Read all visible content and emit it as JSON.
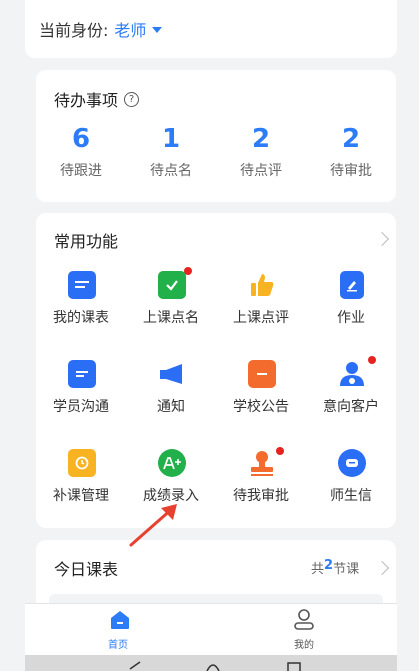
{
  "identity": {
    "label": "当前身份:",
    "role": "老师"
  },
  "todo": {
    "title": "待办事项",
    "help_icon": "question-circle-icon",
    "items": [
      {
        "count": "6",
        "label": "待跟进"
      },
      {
        "count": "1",
        "label": "待点名"
      },
      {
        "count": "2",
        "label": "待点评"
      },
      {
        "count": "2",
        "label": "待审批"
      }
    ]
  },
  "functions": {
    "title": "常用功能",
    "items": [
      {
        "label": "我的课表",
        "icon": "calendar-list-icon",
        "color": "#2b6ef6",
        "badge": false
      },
      {
        "label": "上课点名",
        "icon": "calendar-check-icon",
        "color": "#22b04b",
        "badge": true
      },
      {
        "label": "上课点评",
        "icon": "thumbs-up-icon",
        "color": "#f7b322",
        "badge": false
      },
      {
        "label": "作业",
        "icon": "document-edit-icon",
        "color": "#2b6ef6",
        "badge": false
      },
      {
        "label": "学员沟通",
        "icon": "chat-bubble-icon",
        "color": "#2b6ef6",
        "badge": false
      },
      {
        "label": "通知",
        "icon": "megaphone-icon",
        "color": "#2b6ef6",
        "badge": false
      },
      {
        "label": "学校公告",
        "icon": "notice-board-icon",
        "color": "#f46b2e",
        "badge": false
      },
      {
        "label": "意向客户",
        "icon": "customer-heart-icon",
        "color": "#2b6ef6",
        "badge": true
      },
      {
        "label": "补课管理",
        "icon": "clock-calendar-icon",
        "color": "#f7b322",
        "badge": false
      },
      {
        "label": "成绩录入",
        "icon": "grade-a-plus-icon",
        "color": "#22b04b",
        "badge": false
      },
      {
        "label": "待我审批",
        "icon": "stamp-icon",
        "color": "#f46b2e",
        "badge": true
      },
      {
        "label": "师生信",
        "icon": "message-circle-icon",
        "color": "#2b6ef6",
        "badge": false
      }
    ]
  },
  "schedule": {
    "title": "今日课表",
    "count_prefix": "共",
    "count": "2",
    "count_suffix": "节课"
  },
  "nav": [
    {
      "label": "首页",
      "icon": "home-icon",
      "active": true
    },
    {
      "label": "我的",
      "icon": "user-icon",
      "active": false
    }
  ],
  "colors": {
    "accent": "#2b7cf6",
    "badge": "#e6231e",
    "arrow": "#e8412f"
  }
}
